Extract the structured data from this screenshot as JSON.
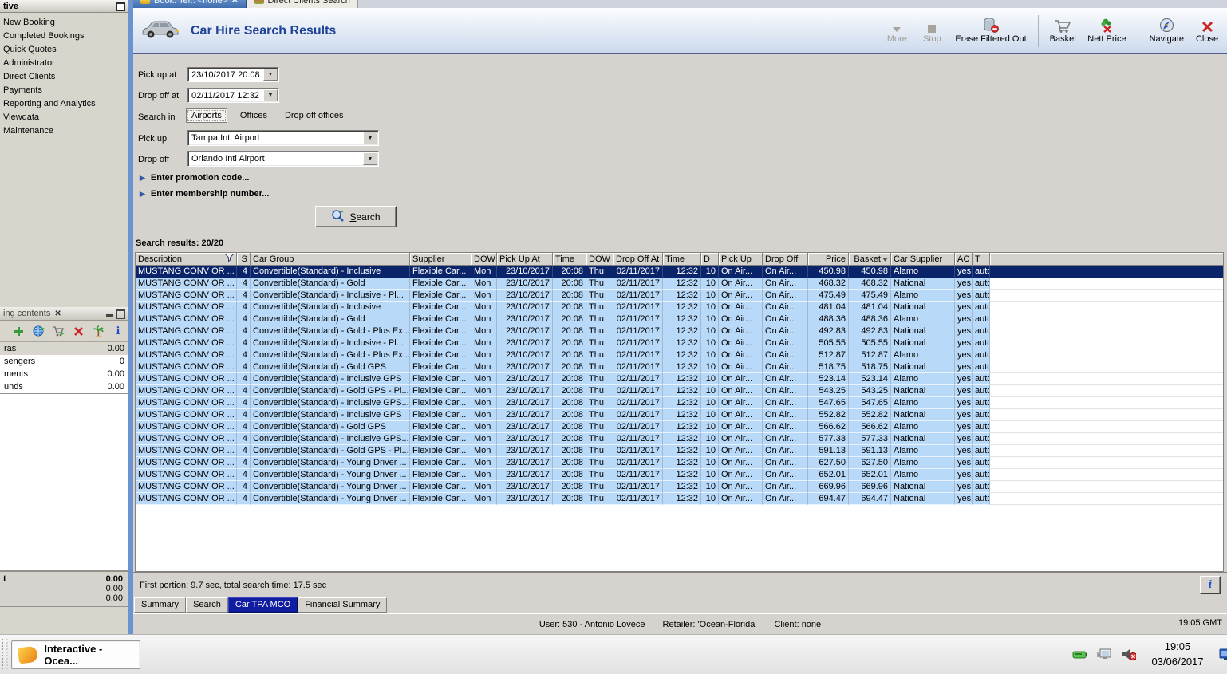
{
  "window_tabs": {
    "booking_tab": "Book. Ter.. <none>",
    "booking_tab_close": "✕",
    "direct_clients_tab": "Direct Clients Search"
  },
  "sidebar": {
    "title": "tive",
    "items": [
      "New Booking",
      "Completed Bookings",
      "Quick Quotes",
      "Administrator",
      "Direct Clients",
      "Payments",
      "Reporting and Analytics",
      "Viewdata",
      "Maintenance"
    ]
  },
  "booking_contents": {
    "tab_label": "ing contents",
    "close_glyph": "✕",
    "rows": [
      {
        "label": "ras",
        "value": "0.00"
      },
      {
        "label": "sengers",
        "value": "0"
      },
      {
        "label": "ments",
        "value": "0.00"
      },
      {
        "label": "unds",
        "value": "0.00"
      }
    ],
    "totals": {
      "label": "t",
      "value_bold": "0.00",
      "value2": "0.00",
      "value3": "0.00"
    }
  },
  "header": {
    "title": "Car Hire Search Results",
    "toolbar": {
      "items": [
        {
          "label": "More",
          "disabled": true
        },
        {
          "label": "Stop",
          "disabled": true
        },
        {
          "label": "Erase Filtered Out",
          "disabled": false
        },
        {
          "label": "Basket",
          "disabled": false
        },
        {
          "label": "Nett Price",
          "disabled": false
        },
        {
          "label": "Navigate",
          "disabled": false
        },
        {
          "label": "Close",
          "disabled": false
        }
      ]
    }
  },
  "form": {
    "pick_up_at_label": "Pick up at",
    "pick_up_at_value": "23/10/2017 20:08",
    "drop_off_at_label": "Drop off at",
    "drop_off_at_value": "02/11/2017 12:32",
    "search_in_label": "Search in",
    "search_in_options": [
      "Airports",
      "Offices",
      "Drop off offices"
    ],
    "search_in_selected": "Airports",
    "pick_up_label": "Pick up",
    "pick_up_value": "Tampa Intl Airport",
    "drop_off_label": "Drop off",
    "drop_off_value": "Orlando Intl Airport",
    "promotion_expander": "Enter promotion code...",
    "membership_expander": "Enter membership number...",
    "search_button_label": "Search"
  },
  "results": {
    "summary_label": "Search results: 20/20",
    "columns": [
      "Description",
      "S",
      "Car Group",
      "Supplier",
      "DOW",
      "Pick Up At",
      "Time",
      "DOW",
      "Drop Off At",
      "Time",
      "D",
      "Pick Up",
      "Drop Off",
      "Price",
      "Basket",
      "Car Supplier",
      "AC",
      "T"
    ],
    "shared": {
      "description": "MUSTANG CONV OR ...",
      "s": "4",
      "supplier": "Flexible Car...",
      "dow_pickup": "Mon",
      "pick_up_at": "23/10/2017",
      "pick_up_time": "20:08",
      "dow_dropoff": "Thu",
      "drop_off_at": "02/11/2017",
      "drop_off_time": "12:32",
      "d": "10",
      "pick_up": "On Air...",
      "drop_off": "On Air...",
      "ac": "yes",
      "t": "auto"
    },
    "rows": [
      {
        "car_group": "Convertible(Standard) - Inclusive",
        "price": "450.98",
        "basket": "450.98",
        "car_supplier": "Alamo"
      },
      {
        "car_group": "Convertible(Standard) - Gold",
        "price": "468.32",
        "basket": "468.32",
        "car_supplier": "National"
      },
      {
        "car_group": "Convertible(Standard) - Inclusive - Pl...",
        "price": "475.49",
        "basket": "475.49",
        "car_supplier": "Alamo"
      },
      {
        "car_group": "Convertible(Standard) - Inclusive",
        "price": "481.04",
        "basket": "481.04",
        "car_supplier": "National"
      },
      {
        "car_group": "Convertible(Standard) - Gold",
        "price": "488.36",
        "basket": "488.36",
        "car_supplier": "Alamo"
      },
      {
        "car_group": "Convertible(Standard) - Gold - Plus Ex...",
        "price": "492.83",
        "basket": "492.83",
        "car_supplier": "National"
      },
      {
        "car_group": "Convertible(Standard) - Inclusive - Pl...",
        "price": "505.55",
        "basket": "505.55",
        "car_supplier": "National"
      },
      {
        "car_group": "Convertible(Standard) - Gold - Plus Ex...",
        "price": "512.87",
        "basket": "512.87",
        "car_supplier": "Alamo"
      },
      {
        "car_group": "Convertible(Standard) - Gold GPS",
        "price": "518.75",
        "basket": "518.75",
        "car_supplier": "National"
      },
      {
        "car_group": "Convertible(Standard) - Inclusive GPS",
        "price": "523.14",
        "basket": "523.14",
        "car_supplier": "Alamo"
      },
      {
        "car_group": "Convertible(Standard) - Gold GPS - Pl...",
        "price": "543.25",
        "basket": "543.25",
        "car_supplier": "National"
      },
      {
        "car_group": "Convertible(Standard) - Inclusive GPS...",
        "price": "547.65",
        "basket": "547.65",
        "car_supplier": "Alamo"
      },
      {
        "car_group": "Convertible(Standard) - Inclusive GPS",
        "price": "552.82",
        "basket": "552.82",
        "car_supplier": "National"
      },
      {
        "car_group": "Convertible(Standard) - Gold GPS",
        "price": "566.62",
        "basket": "566.62",
        "car_supplier": "Alamo"
      },
      {
        "car_group": "Convertible(Standard) - Inclusive GPS...",
        "price": "577.33",
        "basket": "577.33",
        "car_supplier": "National"
      },
      {
        "car_group": "Convertible(Standard) - Gold GPS - Pl...",
        "price": "591.13",
        "basket": "591.13",
        "car_supplier": "Alamo"
      },
      {
        "car_group": "Convertible(Standard) - Young Driver ...",
        "price": "627.50",
        "basket": "627.50",
        "car_supplier": "Alamo"
      },
      {
        "car_group": "Convertible(Standard) - Young Driver ...",
        "price": "652.01",
        "basket": "652.01",
        "car_supplier": "Alamo"
      },
      {
        "car_group": "Convertible(Standard) - Young Driver ...",
        "price": "669.96",
        "basket": "669.96",
        "car_supplier": "National"
      },
      {
        "car_group": "Convertible(Standard) - Young Driver ...",
        "price": "694.47",
        "basket": "694.47",
        "car_supplier": "National"
      }
    ],
    "selected_row_index": 0,
    "timing": "First portion: 9.7 sec, total search time: 17.5 sec",
    "info_button_label": "i"
  },
  "bottom_tabs": {
    "items": [
      "Summary",
      "Search",
      "Car TPA MCO",
      "Financial Summary"
    ],
    "active_index": 2
  },
  "status_bar": {
    "user": "User: 530 - Antonio Lovece",
    "retailer": "Retailer: 'Ocean-Florida'",
    "client": "Client: none",
    "time": "19:05 GMT"
  },
  "taskbar": {
    "app_button": "Interactive - Ocea...",
    "clock_time": "19:05",
    "clock_date": "03/06/2017"
  }
}
